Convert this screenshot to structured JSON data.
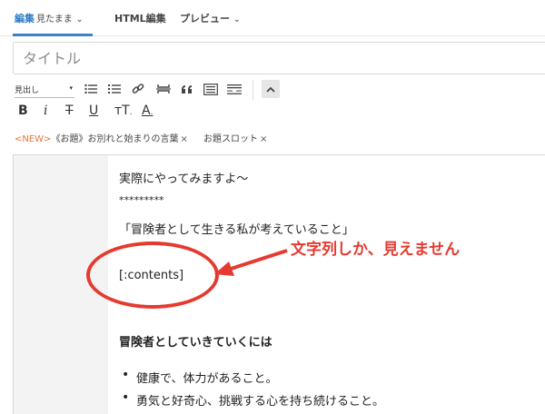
{
  "tabs": {
    "edit_label": "編集",
    "edit_mode": "見たまま",
    "html_label": "HTML編集",
    "preview_label": "プレビュー"
  },
  "title_field": {
    "value": "",
    "placeholder": "タイトル"
  },
  "toolbar": {
    "heading_select": "見出し",
    "icons": [
      "bulleted-list-icon",
      "numbered-list-icon",
      "link-icon",
      "page-break-icon",
      "quote-icon",
      "table-of-contents-icon",
      "read-more-icon",
      "collapse-toolbar-icon"
    ],
    "format_buttons": {
      "bold": "B",
      "italic": "i",
      "strikethrough": "T",
      "underline": "U",
      "text_size": "тT",
      "text_color": "A"
    }
  },
  "tags": {
    "new_badge": "<NEW>",
    "topic_tag": "《お題》お別れと始まりの言葉",
    "slot_tag": "お題スロット",
    "remove": "×"
  },
  "content": {
    "line1": "実際にやってみますよ～",
    "separator": "*********",
    "quote_line": "「冒険者として生きる私が考えていること」",
    "contents_tag": "[:contents]",
    "heading": "冒険者としていきていくには",
    "bullets": [
      "健康で、体力があること。",
      "勇気と好奇心、挑戦する心を持ち続けること。"
    ]
  },
  "annotation": {
    "text": "文字列しか、見えません",
    "color": "#e53a2f"
  },
  "colors": {
    "accent": "#3b82cc",
    "new_badge": "#e8743b",
    "annotation": "#e53a2f"
  }
}
